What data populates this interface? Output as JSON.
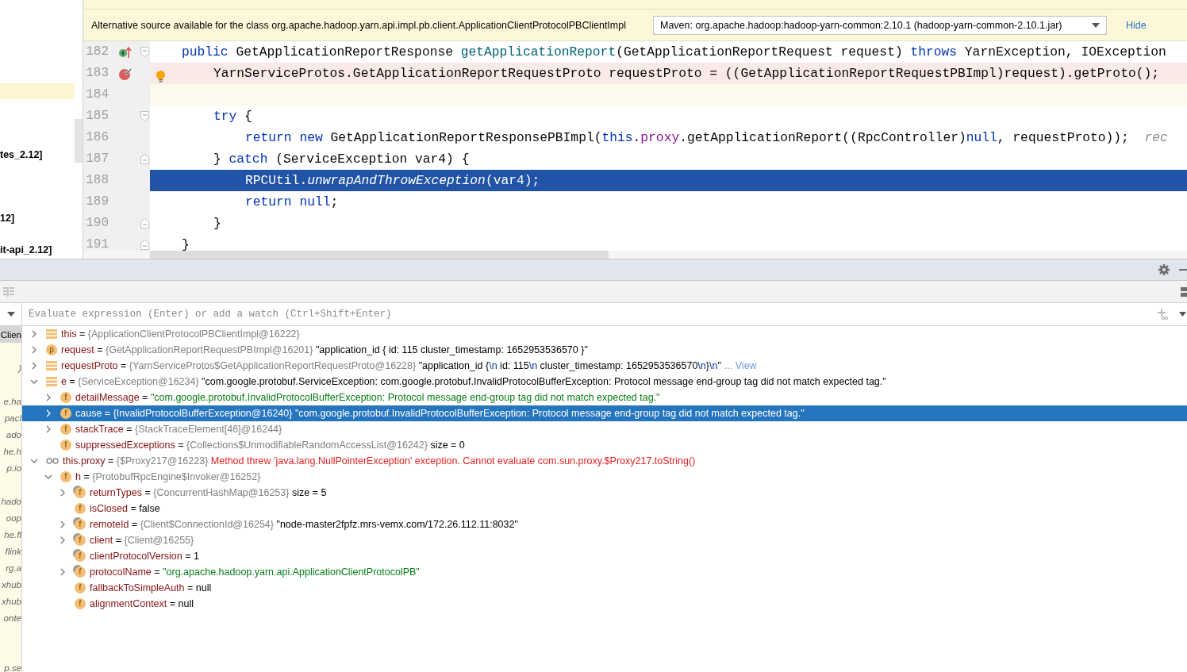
{
  "project_tree": {
    "items": [
      {
        "selected": true
      },
      {
        "selected": false
      },
      {
        "selected": false
      },
      {
        "selected": false
      },
      {
        "label": "tes_2.12]",
        "selected": false
      },
      {
        "selected": false
      },
      {
        "selected": false
      },
      {
        "selected": false
      },
      {
        "label": "12]",
        "selected": false
      },
      {
        "selected": false
      },
      {
        "label": "it-api_2.12]",
        "selected": false
      }
    ]
  },
  "source_banner": {
    "message": "Alternative source available for the class org.apache.hadoop.yarn.api.impl.pb.client.ApplicationClientProtocolPBClientImpl",
    "source_select": "Maven: org.apache.hadoop:hadoop-yarn-common:2.10.1 (hadoop-yarn-common-2.10.1.jar)",
    "hide_link": "Hide"
  },
  "editor": {
    "lines": [
      {
        "number": "182",
        "kind": "code",
        "markers": [
          {
            "kind": "override"
          }
        ],
        "fold_marker": {
          "kind": "start"
        },
        "tokens": [
          {
            "t": "public",
            "kind": "kw"
          },
          {
            "t": " GetApplicationReportResponse ",
            "kind": "plain"
          },
          {
            "t": "getApplicationReport",
            "kind": "fn"
          },
          {
            "t": "(GetApplicationReportRequest request) ",
            "kind": "plain"
          },
          {
            "t": "throws",
            "kind": "kw"
          },
          {
            "t": " YarnException, IOException",
            "kind": "plain"
          }
        ],
        "children": [
          {
            "number": "183",
            "kind": "breakpoint",
            "markers": [
              {
                "kind": "breakpoint"
              }
            ],
            "bulb": true,
            "tokens": [
              {
                "t": "YarnServiceProtos.GetApplicationReportRequestProto requestProto = ((GetApplicationReportRequestPBImpl)request).getProto();",
                "kind": "plain"
              }
            ]
          },
          {
            "number": "184",
            "kind": "caret"
          },
          {
            "number": "185",
            "kind": "code",
            "fold_marker": {
              "kind": "start"
            },
            "tokens": [
              {
                "t": "try",
                "kind": "kw"
              },
              {
                "t": " {",
                "kind": "plain"
              }
            ],
            "children": [
              {
                "number": "186",
                "kind": "code",
                "tokens": [
                  {
                    "t": "return",
                    "kind": "kw"
                  },
                  {
                    "t": " new",
                    "kind": "kw"
                  },
                  {
                    "t": " GetApplicationReportResponsePBImpl(",
                    "kind": "plain"
                  },
                  {
                    "t": "this",
                    "kind": "kw"
                  },
                  {
                    "t": ".",
                    "kind": "plain"
                  },
                  {
                    "t": "proxy",
                    "kind": "field"
                  },
                  {
                    "t": ".getApplicationReport((RpcController)",
                    "kind": "plain"
                  },
                  {
                    "t": "null",
                    "kind": "kw"
                  },
                  {
                    "t": ", requestProto));",
                    "kind": "plain"
                  },
                  {
                    "t": "  rec",
                    "kind": "comment"
                  }
                ]
              }
            ]
          },
          {
            "number": "187",
            "kind": "code",
            "fold_marker": {
              "kind": "end"
            },
            "tokens": [
              {
                "t": "} ",
                "kind": "plain"
              },
              {
                "t": "catch",
                "kind": "kw"
              },
              {
                "t": " (ServiceException var4) {",
                "kind": "plain"
              }
            ],
            "children": [
              {
                "number": "188",
                "kind": "execution",
                "tokens": [
                  {
                    "t": "RPCUtil.",
                    "kind": "plain"
                  },
                  {
                    "t": "unwrapAndThrowException",
                    "kind": "italic"
                  },
                  {
                    "t": "(var4);",
                    "kind": "plain"
                  }
                ]
              },
              {
                "number": "189",
                "kind": "code",
                "tokens": [
                  {
                    "t": "return",
                    "kind": "kw"
                  },
                  {
                    "t": " null",
                    "kind": "kw"
                  },
                  {
                    "t": ";",
                    "kind": "plain"
                  }
                ]
              }
            ]
          },
          {
            "number": "190",
            "kind": "code",
            "fold_marker": {
              "kind": "end"
            },
            "tokens": [
              {
                "t": "}",
                "kind": "plain"
              }
            ]
          }
        ]
      },
      {
        "number": "191",
        "kind": "code",
        "fold_marker": {
          "kind": "end"
        },
        "tokens": [
          {
            "t": "}",
            "kind": "plain"
          }
        ]
      }
    ]
  },
  "debugger": {
    "frames": [
      {
        "label": "Clien",
        "selected": true
      },
      {
        "selected": false
      },
      {
        "label": ")",
        "selected": false
      },
      {
        "selected": false
      },
      {
        "label": "e.ha",
        "selected": false
      },
      {
        "label": "pacl",
        "selected": false
      },
      {
        "label": "ado",
        "selected": false
      },
      {
        "label": "he.h",
        "selected": false
      },
      {
        "label": "p.io",
        "selected": false
      },
      {
        "selected": false
      },
      {
        "label": "hado",
        "selected": false
      },
      {
        "label": "oop",
        "selected": false
      },
      {
        "label": "he.fl",
        "selected": false
      },
      {
        "label": "flink",
        "selected": false
      },
      {
        "label": "rg.a",
        "selected": false
      },
      {
        "label": "xhub",
        "selected": false
      },
      {
        "label": "xhub",
        "selected": false
      },
      {
        "label": "onte",
        "selected": false
      },
      {
        "selected": false
      },
      {
        "selected": false
      },
      {
        "label": "p.se",
        "selected": false
      }
    ],
    "evaluate_placeholder": "Evaluate expression (Enter) or add a watch (Ctrl+Shift+Enter)",
    "variables": [
      {
        "kind": "local",
        "expanded": false,
        "selected": false,
        "name": "this",
        "separator": "=",
        "ref": "{ApplicationClientProtocolPBClientImpl@16222}"
      },
      {
        "kind": "param",
        "badge": "p",
        "expanded": false,
        "selected": false,
        "name": "request",
        "separator": "=",
        "ref": "{GetApplicationReportRequestPBImpl@16201}",
        "value_parts": [
          {
            "t": "\"application_id { id: 115 cluster_timestamp: 1652953536570 }\"",
            "kind": "plain"
          }
        ]
      },
      {
        "kind": "local",
        "expanded": false,
        "selected": false,
        "name": "requestProto",
        "separator": "=",
        "ref": "{YarnServiceProtos$GetApplicationReportRequestProto@16228}",
        "value_parts": [
          {
            "t": "\"application_id {",
            "kind": "plain"
          },
          {
            "t": "\\n",
            "kind": "escape"
          },
          {
            "t": "  id: 115",
            "kind": "plain"
          },
          {
            "t": "\\n",
            "kind": "escape"
          },
          {
            "t": "  cluster_timestamp: 1652953536570",
            "kind": "plain"
          },
          {
            "t": "\\n",
            "kind": "escape"
          },
          {
            "t": "}",
            "kind": "plain"
          },
          {
            "t": "\\n",
            "kind": "escape"
          },
          {
            "t": "\"",
            "kind": "plain"
          }
        ],
        "link": "... View"
      },
      {
        "kind": "local",
        "expanded": true,
        "selected": false,
        "name": "e",
        "separator": "=",
        "ref": "{ServiceException@16234}",
        "value_parts": [
          {
            "t": "\"com.google.protobuf.ServiceException: com.google.protobuf.InvalidProtocolBufferException: Protocol message end-group tag did not match expected tag.\"",
            "kind": "plain"
          }
        ],
        "children": [
          {
            "kind": "field",
            "badge": "f",
            "expanded": false,
            "selected": false,
            "name": "detailMessage",
            "separator": "=",
            "value_parts": [
              {
                "t": "\"com.google.protobuf.InvalidProtocolBufferException: Protocol message end-group tag did not match expected tag.\"",
                "kind": "string"
              }
            ]
          },
          {
            "kind": "field",
            "badge": "f",
            "expanded": false,
            "selected": true,
            "name": "cause",
            "separator": "=",
            "ref": "{InvalidProtocolBufferException@16240}",
            "value_parts": [
              {
                "t": "\"com.google.protobuf.InvalidProtocolBufferException: Protocol message end-group tag did not match expected tag.\"",
                "kind": "plain"
              }
            ]
          },
          {
            "kind": "field",
            "badge": "f",
            "expanded": false,
            "selected": false,
            "name": "stackTrace",
            "separator": "=",
            "ref": "{StackTraceElement[46]@16244}"
          },
          {
            "kind": "field",
            "badge": "f",
            "selected": false,
            "name": "suppressedExceptions",
            "separator": "=",
            "ref": "{Collections$UnmodifiableRandomAccessList@16242}",
            "value_parts": [
              {
                "t": " size = 0",
                "kind": "plain"
              }
            ]
          }
        ]
      },
      {
        "kind": "watch",
        "expanded": true,
        "selected": false,
        "name": "this.proxy",
        "separator": "=",
        "ref": "{$Proxy217@16223}",
        "value_parts": [
          {
            "t": "Method threw 'java.lang.NullPointerException' exception. Cannot evaluate com.sun.proxy.$Proxy217.toString()",
            "kind": "error"
          }
        ],
        "children": [
          {
            "kind": "field",
            "badge": "f",
            "expanded": true,
            "selected": false,
            "name": "h",
            "separator": "=",
            "ref": "{ProtobufRpcEngine$Invoker@16252}",
            "children": [
              {
                "kind": "final_field",
                "badge": "f",
                "expanded": false,
                "selected": false,
                "name": "returnTypes",
                "separator": "=",
                "ref": "{ConcurrentHashMap@16253}",
                "value_parts": [
                  {
                    "t": " size = 5",
                    "kind": "plain"
                  }
                ]
              },
              {
                "kind": "field",
                "badge": "f",
                "selected": false,
                "name": "isClosed",
                "separator": "=",
                "value_parts": [
                  {
                    "t": "false",
                    "kind": "plain"
                  }
                ]
              },
              {
                "kind": "final_field",
                "badge": "f",
                "expanded": false,
                "selected": false,
                "name": "remoteId",
                "separator": "=",
                "ref": "{Client$ConnectionId@16254}",
                "value_parts": [
                  {
                    "t": "\"node-master2fpfz.mrs-vemx.com/172.26.112.11:8032\"",
                    "kind": "plain"
                  }
                ]
              },
              {
                "kind": "final_field",
                "badge": "f",
                "expanded": false,
                "selected": false,
                "name": "client",
                "separator": "=",
                "ref": "{Client@16255}"
              },
              {
                "kind": "final_field",
                "badge": "f",
                "selected": false,
                "name": "clientProtocolVersion",
                "separator": "=",
                "value_parts": [
                  {
                    "t": "1",
                    "kind": "plain"
                  }
                ]
              },
              {
                "kind": "final_field",
                "badge": "f",
                "expanded": false,
                "selected": false,
                "name": "protocolName",
                "separator": "=",
                "value_parts": [
                  {
                    "t": "\"org.apache.hadoop.yarn.api.ApplicationClientProtocolPB\"",
                    "kind": "string"
                  }
                ]
              },
              {
                "kind": "field",
                "badge": "f",
                "selected": false,
                "name": "fallbackToSimpleAuth",
                "separator": "=",
                "value_parts": [
                  {
                    "t": "null",
                    "kind": "plain"
                  }
                ]
              },
              {
                "kind": "field",
                "badge": "f",
                "selected": false,
                "name": "alignmentContext",
                "separator": "=",
                "value_parts": [
                  {
                    "t": "null",
                    "kind": "plain"
                  }
                ]
              }
            ]
          }
        ]
      }
    ]
  }
}
